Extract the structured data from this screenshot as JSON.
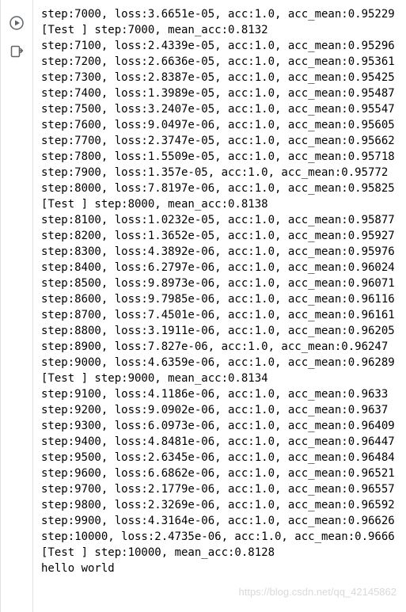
{
  "watermark": "https://blog.csdn.net/qq_42145862",
  "icons": {
    "run": "run-icon",
    "output": "output-icon"
  },
  "lines": [
    "step:7000, loss:3.6651e-05, acc:1.0, acc_mean:0.95229",
    "[Test ] step:7000,  mean_acc:0.8132",
    "step:7100, loss:2.4339e-05, acc:1.0, acc_mean:0.95296",
    "step:7200, loss:2.6636e-05, acc:1.0, acc_mean:0.95361",
    "step:7300, loss:2.8387e-05, acc:1.0, acc_mean:0.95425",
    "step:7400, loss:1.3989e-05, acc:1.0, acc_mean:0.95487",
    "step:7500, loss:3.2407e-05, acc:1.0, acc_mean:0.95547",
    "step:7600, loss:9.0497e-06, acc:1.0, acc_mean:0.95605",
    "step:7700, loss:2.3747e-05, acc:1.0, acc_mean:0.95662",
    "step:7800, loss:1.5509e-05, acc:1.0, acc_mean:0.95718",
    "step:7900, loss:1.357e-05, acc:1.0, acc_mean:0.95772",
    "step:8000, loss:7.8197e-06, acc:1.0, acc_mean:0.95825",
    "[Test ] step:8000,  mean_acc:0.8138",
    "step:8100, loss:1.0232e-05, acc:1.0, acc_mean:0.95877",
    "step:8200, loss:1.3652e-05, acc:1.0, acc_mean:0.95927",
    "step:8300, loss:4.3892e-06, acc:1.0, acc_mean:0.95976",
    "step:8400, loss:6.2797e-06, acc:1.0, acc_mean:0.96024",
    "step:8500, loss:9.8973e-06, acc:1.0, acc_mean:0.96071",
    "step:8600, loss:9.7985e-06, acc:1.0, acc_mean:0.96116",
    "step:8700, loss:7.4501e-06, acc:1.0, acc_mean:0.96161",
    "step:8800, loss:3.1911e-06, acc:1.0, acc_mean:0.96205",
    "step:8900, loss:7.827e-06, acc:1.0, acc_mean:0.96247",
    "step:9000, loss:4.6359e-06, acc:1.0, acc_mean:0.96289",
    "[Test ] step:9000,  mean_acc:0.8134",
    "step:9100, loss:4.1186e-06, acc:1.0, acc_mean:0.9633",
    "step:9200, loss:9.0902e-06, acc:1.0, acc_mean:0.9637",
    "step:9300, loss:6.0973e-06, acc:1.0, acc_mean:0.96409",
    "step:9400, loss:4.8481e-06, acc:1.0, acc_mean:0.96447",
    "step:9500, loss:2.6345e-06, acc:1.0, acc_mean:0.96484",
    "step:9600, loss:6.6862e-06, acc:1.0, acc_mean:0.96521",
    "step:9700, loss:2.1779e-06, acc:1.0, acc_mean:0.96557",
    "step:9800, loss:2.3269e-06, acc:1.0, acc_mean:0.96592",
    "step:9900, loss:4.3164e-06, acc:1.0, acc_mean:0.96626",
    "step:10000, loss:2.4735e-06, acc:1.0, acc_mean:0.9666",
    "[Test ] step:10000,  mean_acc:0.8128",
    "hello world"
  ]
}
